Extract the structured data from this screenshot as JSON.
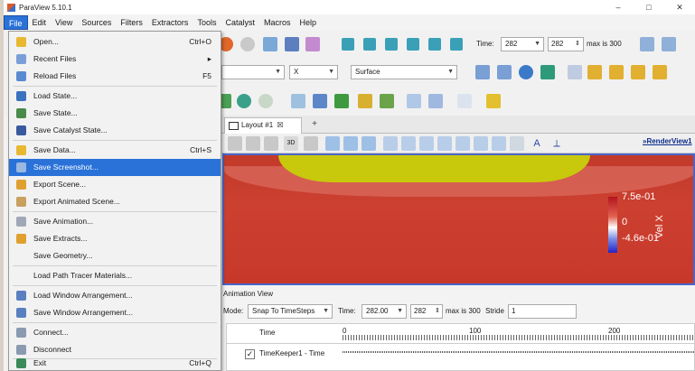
{
  "window": {
    "title": "ParaView 5.10.1",
    "controls": [
      "–",
      "□",
      "✕"
    ]
  },
  "menubar": [
    "File",
    "Edit",
    "View",
    "Sources",
    "Filters",
    "Extractors",
    "Tools",
    "Catalyst",
    "Macros",
    "Help"
  ],
  "toolbar": {
    "time_label": "Time:",
    "time_value": "282",
    "step_value": "282",
    "max_label": "max is 300",
    "component_value": "X",
    "representation_value": "Surface"
  },
  "file_menu": {
    "items": [
      {
        "label": "Open...",
        "shortcut": "Ctrl+O",
        "icon": "folder-open-icon"
      },
      {
        "label": "Recent Files",
        "shortcut": "▸",
        "icon": "recent-files-icon"
      },
      {
        "label": "Reload Files",
        "shortcut": "F5",
        "icon": "reload-icon"
      },
      {
        "label": "Load State...",
        "shortcut": "",
        "icon": "load-state-icon"
      },
      {
        "label": "Save State...",
        "shortcut": "",
        "icon": "save-state-icon"
      },
      {
        "label": "Save Catalyst State...",
        "shortcut": "",
        "icon": "catalyst-icon"
      },
      {
        "label": "Save Data...",
        "shortcut": "Ctrl+S",
        "icon": "save-data-icon"
      },
      {
        "label": "Save Screenshot...",
        "shortcut": "",
        "icon": "camera-icon"
      },
      {
        "label": "Export Scene...",
        "shortcut": "",
        "icon": "export-scene-icon"
      },
      {
        "label": "Export Animated Scene...",
        "shortcut": "",
        "icon": "export-animated-icon"
      },
      {
        "label": "Save Animation...",
        "shortcut": "",
        "icon": "save-animation-icon"
      },
      {
        "label": "Save Extracts...",
        "shortcut": "",
        "icon": "save-extracts-icon"
      },
      {
        "label": "Save Geometry...",
        "shortcut": "",
        "icon": ""
      },
      {
        "label": "Load Path Tracer Materials...",
        "shortcut": "",
        "icon": ""
      },
      {
        "label": "Load Window Arrangement...",
        "shortcut": "",
        "icon": "load-window-icon"
      },
      {
        "label": "Save Window Arrangement...",
        "shortcut": "",
        "icon": "save-window-icon"
      },
      {
        "label": "Connect...",
        "shortcut": "",
        "icon": "connect-icon"
      },
      {
        "label": "Disconnect",
        "shortcut": "",
        "icon": "disconnect-icon"
      },
      {
        "label": "Exit",
        "shortcut": "Ctrl+Q",
        "icon": "exit-icon"
      }
    ]
  },
  "layout_tab": {
    "label": "Layout #1",
    "close": "☒",
    "plus": "+"
  },
  "render_view": {
    "label": "RenderView1",
    "colorbar": {
      "title": "Vel X",
      "max": "7.5e-01",
      "mid": "0",
      "min": "-4.6e-01"
    }
  },
  "animation": {
    "title": "Animation View",
    "mode_label": "Mode:",
    "mode_value": "Snap To TimeSteps",
    "time_label": "Time:",
    "time_value": "282.00",
    "step_value": "282",
    "max_label": "max is 300",
    "stride_label": "Stride",
    "stride_value": "1",
    "col_time": "Time",
    "ticks": [
      "0",
      "100",
      "200"
    ],
    "row_label": "TimeKeeper1 - Time",
    "check": "✓"
  },
  "colors": {
    "selection": "#2a72d8",
    "render_red": "#c7382a",
    "render_yellow": "#c8c80c",
    "view_border": "#4a66c9"
  }
}
